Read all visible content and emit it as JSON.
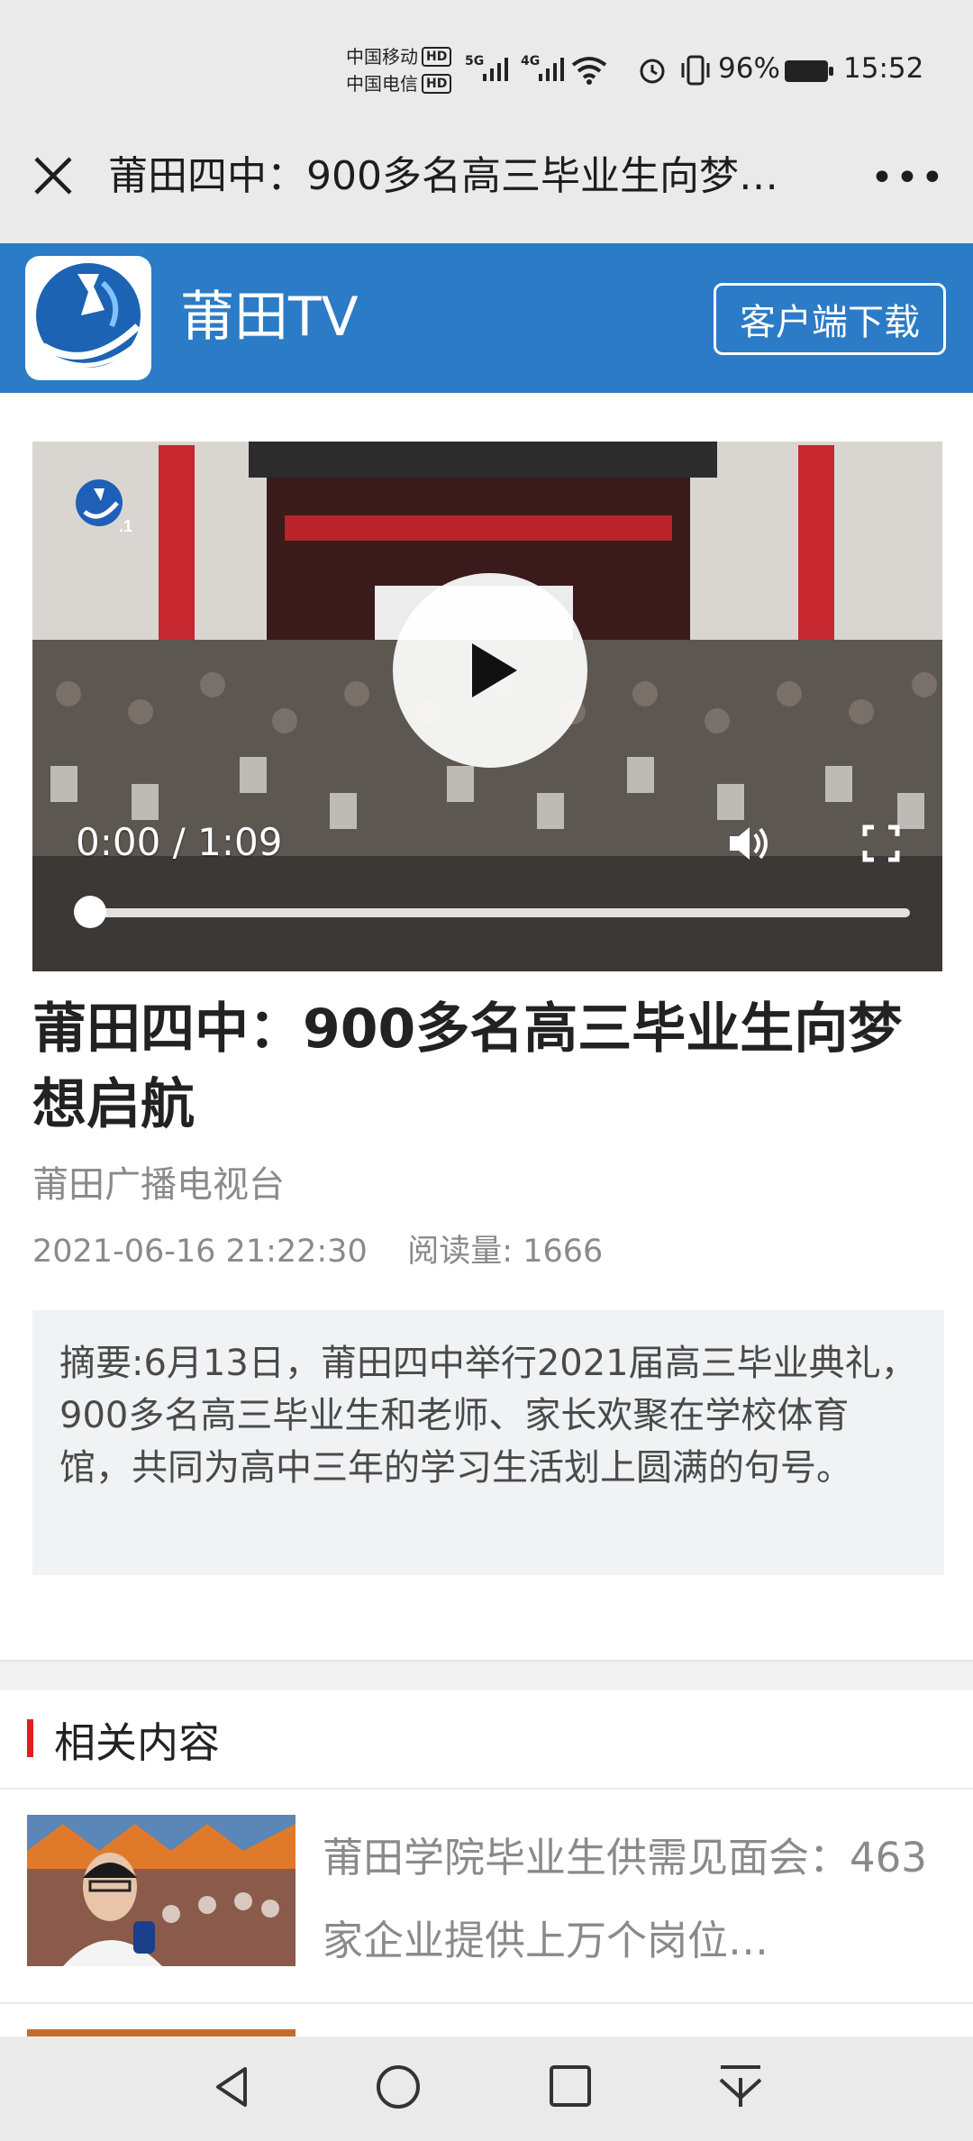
{
  "status_bar": {
    "carrier1": "中国移动",
    "carrier2": "中国电信",
    "hd_badge": "HD",
    "net1": "5G",
    "net2": "4G",
    "battery": "96%",
    "time": "15:52"
  },
  "title_bar": {
    "title": "莆田四中：900多名高三毕业生向梦…",
    "more_label": "•••"
  },
  "brand": {
    "name": "莆田TV",
    "download_label": "客户端下载",
    "accent": "#2b7bc6"
  },
  "video": {
    "timecode": "0:00 / 1:09",
    "progress": 0,
    "station_mark": ".1"
  },
  "article": {
    "headline": "莆田四中：900多名高三毕业生向梦想启航",
    "source": "莆田广播电视台",
    "datetime": "2021-06-16 21:22:30",
    "read_label": "阅读量:",
    "read_count": "1666",
    "summary": "摘要:6月13日，莆田四中举行2021届高三毕业典礼，900多名高三毕业生和老师、家长欢聚在学校体育馆，共同为高中三年的学习生活划上圆满的句号。"
  },
  "related": {
    "heading": "相关内容",
    "marker_color": "#e02020",
    "items": [
      {
        "title": "莆田学院毕业生供需见面会：463家企业提供上万个岗位…"
      }
    ]
  },
  "icons": {
    "close": "close-icon",
    "more": "more-icon",
    "play": "play-icon",
    "volume": "volume-icon",
    "fullscreen": "fullscreen-icon",
    "nav_back": "back-triangle-icon",
    "nav_home": "home-circle-icon",
    "nav_recent": "recent-square-icon",
    "nav_down": "download-arrow-icon"
  }
}
